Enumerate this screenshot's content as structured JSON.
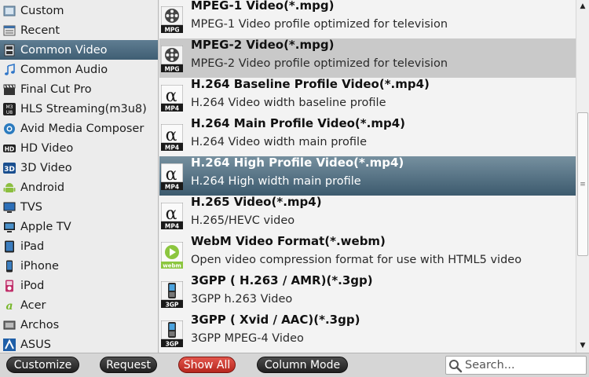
{
  "categories": [
    {
      "label": "Custom",
      "icon": "custom-icon",
      "selected": false
    },
    {
      "label": "Recent",
      "icon": "recent-icon",
      "selected": false
    },
    {
      "label": "Common Video",
      "icon": "common-video-icon",
      "selected": true
    },
    {
      "label": "Common Audio",
      "icon": "music-note-icon",
      "selected": false
    },
    {
      "label": "Final Cut Pro",
      "icon": "clapperboard-icon",
      "selected": false
    },
    {
      "label": "HLS Streaming(m3u8)",
      "icon": "m3u8-icon",
      "selected": false
    },
    {
      "label": "Avid Media Composer",
      "icon": "avid-icon",
      "selected": false
    },
    {
      "label": "HD Video",
      "icon": "hd-icon",
      "selected": false
    },
    {
      "label": "3D Video",
      "icon": "3d-icon",
      "selected": false
    },
    {
      "label": "Android",
      "icon": "android-icon",
      "selected": false
    },
    {
      "label": "TVS",
      "icon": "tv-icon",
      "selected": false
    },
    {
      "label": "Apple TV",
      "icon": "apple-tv-icon",
      "selected": false
    },
    {
      "label": "iPad",
      "icon": "ipad-icon",
      "selected": false
    },
    {
      "label": "iPhone",
      "icon": "iphone-icon",
      "selected": false
    },
    {
      "label": "iPod",
      "icon": "ipod-icon",
      "selected": false
    },
    {
      "label": "Acer",
      "icon": "acer-icon",
      "selected": false
    },
    {
      "label": "Archos",
      "icon": "archos-icon",
      "selected": false
    },
    {
      "label": "ASUS",
      "icon": "asus-icon",
      "selected": false
    }
  ],
  "formats": [
    {
      "title": "MPEG-1 Video(*.mpg)",
      "desc": "MPEG-1 Video profile optimized for television",
      "icon": "mpg-film-icon",
      "badge": "MPG",
      "state": "normal"
    },
    {
      "title": "MPEG-2 Video(*.mpg)",
      "desc": "MPEG-2 Video profile optimized for television",
      "icon": "mpg-film-icon",
      "badge": "MPG",
      "state": "hover"
    },
    {
      "title": "H.264 Baseline Profile Video(*.mp4)",
      "desc": "H.264 Video width baseline profile",
      "icon": "mp4-alpha-icon",
      "badge": "MP4",
      "state": "normal"
    },
    {
      "title": "H.264 Main Profile Video(*.mp4)",
      "desc": "H.264 Video width main profile",
      "icon": "mp4-alpha-icon",
      "badge": "MP4",
      "state": "normal"
    },
    {
      "title": "H.264 High Profile Video(*.mp4)",
      "desc": "H.264 High width main profile",
      "icon": "mp4-alpha-icon",
      "badge": "MP4",
      "state": "selected"
    },
    {
      "title": "H.265 Video(*.mp4)",
      "desc": "H.265/HEVC video",
      "icon": "mp4-alpha-icon",
      "badge": "MP4",
      "state": "normal"
    },
    {
      "title": "WebM Video Format(*.webm)",
      "desc": "Open video compression format for use with HTML5 video",
      "icon": "webm-play-icon",
      "badge": "webm",
      "state": "normal"
    },
    {
      "title": "3GPP ( H.263 / AMR)(*.3gp)",
      "desc": "3GPP h.263 Video",
      "icon": "3gp-phone-icon",
      "badge": "3GP",
      "state": "normal"
    },
    {
      "title": "3GPP ( Xvid / AAC)(*.3gp)",
      "desc": "3GPP MPEG-4 Video",
      "icon": "3gp-phone-icon",
      "badge": "3GP",
      "state": "normal"
    }
  ],
  "buttons": {
    "customize": "Customize",
    "request": "Request",
    "show_all": "Show All",
    "column_mode": "Column Mode"
  },
  "search": {
    "placeholder": "Search...",
    "value": ""
  },
  "colors": {
    "selection": "#4a6a80",
    "hover": "#c9c9c9",
    "show_all_red": "#c8352b"
  }
}
